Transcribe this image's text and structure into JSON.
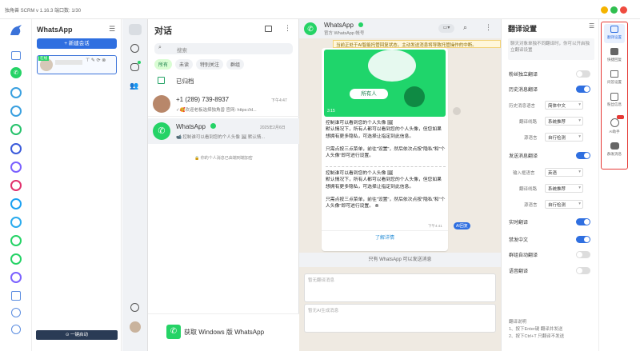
{
  "app": {
    "title": "独角兽 SCRM v 1.16.3    端口数: 1/30"
  },
  "account": {
    "name": "WhatsApp",
    "new_session": "+ 新建会话",
    "session_tag": "在线",
    "one_click_start": "⊙ 一键启动"
  },
  "chatlist": {
    "title": "对话",
    "search_placeholder": "搜索",
    "filters": [
      "所有",
      "未读",
      "特别关注",
      "群组"
    ],
    "archived": "已归档",
    "chats": [
      {
        "name": "+1 (289) 739-8937",
        "time": "下午4:47",
        "preview": "✓🥰欢迎老板选择独角兽 官网: https://d..."
      },
      {
        "name": "WhatsApp",
        "time": "2025年2月6日",
        "preview": "📹 控制谁可以看到您的个人头像 🖼 默认情..."
      }
    ],
    "encrypted_note": "🔒 你的个人消息已由端到端加密",
    "get_windows": "获取 Windows 版 WhatsApp"
  },
  "conv": {
    "name": "WhatsApp",
    "subtitle": "官方 WhatsApp 帐号",
    "banner": "当前正处于AI智能托管回复状态，主动发送消息将导致托管操作的中断。",
    "img_label": "所有人",
    "img_time": "3:15",
    "msg1": "控制谁可以看到您的个人头像 🖼\n默认情况下，所有人都可以看到您的个人头像，但您如果想拥有更多隐私，可选择让指定到此信息。\n\n只需点按三点菜单，前往\"设置\"，然后依次点按\"隐私\"和\"个人头像\"即可进行设置。",
    "msg2": "控制谁可以看到您的个人头像 🖼\n默认情况下，所有人都可以看到您的个人头像，但您如果想拥有更多隐私，可选择让指定到此信息。\n\n只需点按三点菜单，前往\"设置\"，然后依次点按\"隐私\"和\"个人头像\"即可进行设置。 ⊗",
    "msg_time": "下午4:41",
    "ai_badge": "AI回复",
    "link": "了解详情",
    "only_official": "只有 WhatsApp 可以发送消息",
    "translate_placeholder": "暂无翻译消息",
    "ai_placeholder": "暂无AI生成消息"
  },
  "trans": {
    "title": "翻译设置",
    "note": "聊天对象单独不同翻译时，你可以开启独立翻译设置",
    "independent": "粉丝独立翻译",
    "history": "历史消息翻译",
    "history_lang": "历史消息语言",
    "history_lang_val": "简体中文",
    "route": "翻译线路",
    "route_val": "系统推荐",
    "source": "源语言",
    "source_val": "自行检测",
    "send": "发送消息翻译",
    "input_lang": "输入框语言",
    "input_lang_val": "英语",
    "send_route": "翻译线路",
    "send_route_val": "系统推荐",
    "send_source": "源语言",
    "send_source_val": "自行检测",
    "realtime": "实时翻译",
    "block_cn": "禁发中文",
    "group_auto": "群组自动翻译",
    "voice": "语音翻译",
    "help_title": "翻译说明",
    "help1": "1、按下Enter键 翻译并发送",
    "help2": "2、按下Ctrl+T 只翻译不发送"
  },
  "tools": [
    {
      "label": "翻译设置"
    },
    {
      "label": "快捷回复"
    },
    {
      "label": "问答设置"
    },
    {
      "label": "粉丝信息"
    },
    {
      "label": "AI助手"
    },
    {
      "label": "群发消息"
    }
  ],
  "colors": {
    "accent": "#2f6fe0",
    "wa_green": "#25d366",
    "highlight": "#e53935"
  }
}
